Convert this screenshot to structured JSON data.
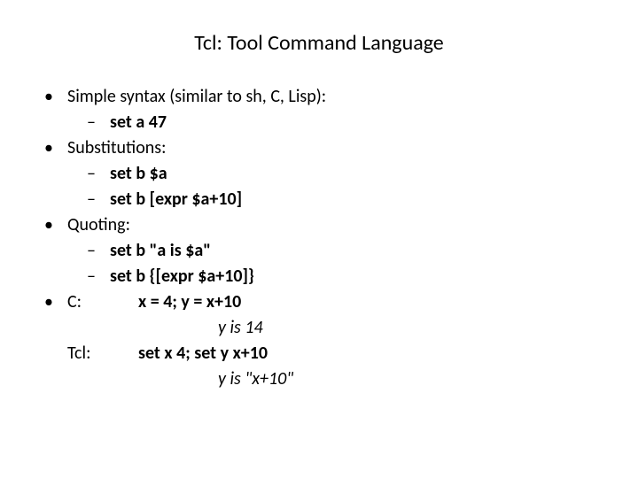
{
  "title": "Tcl: Tool Command Language",
  "b1": "Simple syntax (similar to sh, C, Lisp):",
  "b1a": "set a 47",
  "b2": "Substitutions:",
  "b2a": "set b $a",
  "b2b": "set b [expr $a+10]",
  "b3": "Quoting:",
  "b3a": "set b \"a is $a\"",
  "b3b": "set b {[expr $a+10]}",
  "cmp": {
    "c_label": "C:",
    "c_code": "x = 4; y = x+10",
    "c_res": "y is 14",
    "tcl_label": "Tcl:",
    "tcl_code": "set x 4; set y x+10",
    "tcl_res": "y is \"x+10\""
  }
}
